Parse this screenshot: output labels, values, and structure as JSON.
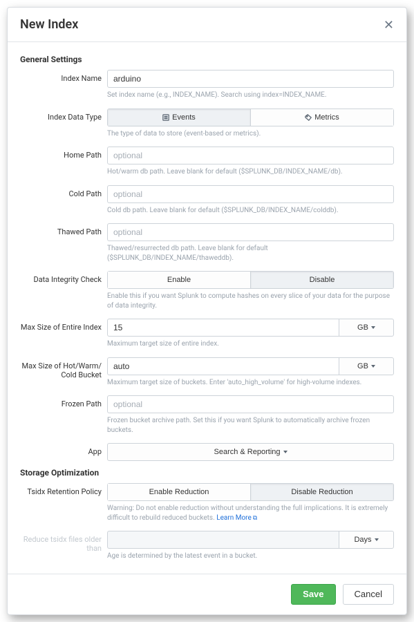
{
  "modal_title": "New Index",
  "sections": {
    "general": "General Settings",
    "storage": "Storage Optimization"
  },
  "labels": {
    "index_name": "Index Name",
    "data_type": "Index Data Type",
    "home_path": "Home Path",
    "cold_path": "Cold Path",
    "thawed_path": "Thawed Path",
    "integrity": "Data Integrity Check",
    "max_size_index": "Max Size of Entire Index",
    "max_size_bucket_1": "Max Size of Hot/Warm/",
    "max_size_bucket_2": "Cold Bucket",
    "frozen_path": "Frozen Path",
    "app": "App",
    "tsidx": "Tsidx Retention Policy",
    "reduce_1": "Reduce tsidx files older",
    "reduce_2": "than"
  },
  "values": {
    "index_name": "arduino",
    "max_size_index": "15",
    "max_size_bucket": "auto",
    "reduce_age": ""
  },
  "placeholders": {
    "optional": "optional"
  },
  "options": {
    "data_type_events": "Events",
    "data_type_metrics": "Metrics",
    "integrity_enable": "Enable",
    "integrity_disable": "Disable",
    "unit_gb": "GB",
    "unit_days": "Days",
    "tsidx_enable": "Enable Reduction",
    "tsidx_disable": "Disable Reduction",
    "app_selected": "Search & Reporting"
  },
  "help": {
    "index_name": "Set index name (e.g., INDEX_NAME). Search using index=INDEX_NAME.",
    "data_type": "The type of data to store (event-based or metrics).",
    "home_path": "Hot/warm db path. Leave blank for default ($SPLUNK_DB/INDEX_NAME/db).",
    "cold_path": "Cold db path. Leave blank for default ($SPLUNK_DB/INDEX_NAME/colddb).",
    "thawed_path": "Thawed/resurrected db path. Leave blank for default ($SPLUNK_DB/INDEX_NAME/thaweddb).",
    "integrity": "Enable this if you want Splunk to compute hashes on every slice of your data for the purpose of data integrity.",
    "max_size_index": "Maximum target size of entire index.",
    "max_size_bucket": "Maximum target size of buckets. Enter 'auto_high_volume' for high-volume indexes.",
    "frozen_path": "Frozen bucket archive path. Set this if you want Splunk to automatically archive frozen buckets.",
    "tsidx_prefix": "Warning: Do not enable reduction without understanding the full implications. It is extremely difficult to rebuild reduced buckets. ",
    "tsidx_link": "Learn More",
    "reduce_age": "Age is determined by the latest event in a bucket."
  },
  "footer": {
    "save": "Save",
    "cancel": "Cancel"
  }
}
